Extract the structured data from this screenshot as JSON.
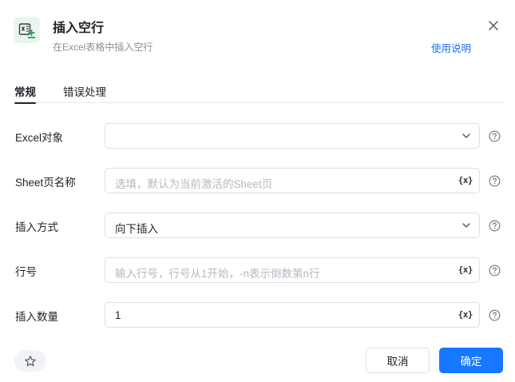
{
  "header": {
    "title": "插入空行",
    "subtitle": "在Excel表格中插入空行",
    "help_link": "使用说明",
    "icon": "excel-insert-row-icon"
  },
  "tabs": [
    {
      "label": "常规",
      "active": true
    },
    {
      "label": "错误处理",
      "active": false
    }
  ],
  "fields": {
    "excel_object": {
      "label": "Excel对象",
      "value": "",
      "type": "select"
    },
    "sheet_name": {
      "label": "Sheet页名称",
      "placeholder": "选填，默认为当前激活的Sheet页",
      "variable_button": "{x}"
    },
    "insert_mode": {
      "label": "插入方式",
      "value": "向下插入",
      "type": "select"
    },
    "row_number": {
      "label": "行号",
      "placeholder": "输入行号，行号从1开始，-n表示倒数第n行",
      "variable_button": "{x}"
    },
    "insert_count": {
      "label": "插入数量",
      "value": "1",
      "variable_button": "{x}"
    }
  },
  "footer": {
    "cancel_label": "取消",
    "confirm_label": "确定"
  },
  "colors": {
    "accent": "#1677ff",
    "link": "#1f6fe5",
    "icon_green": "#2a9d5c"
  }
}
